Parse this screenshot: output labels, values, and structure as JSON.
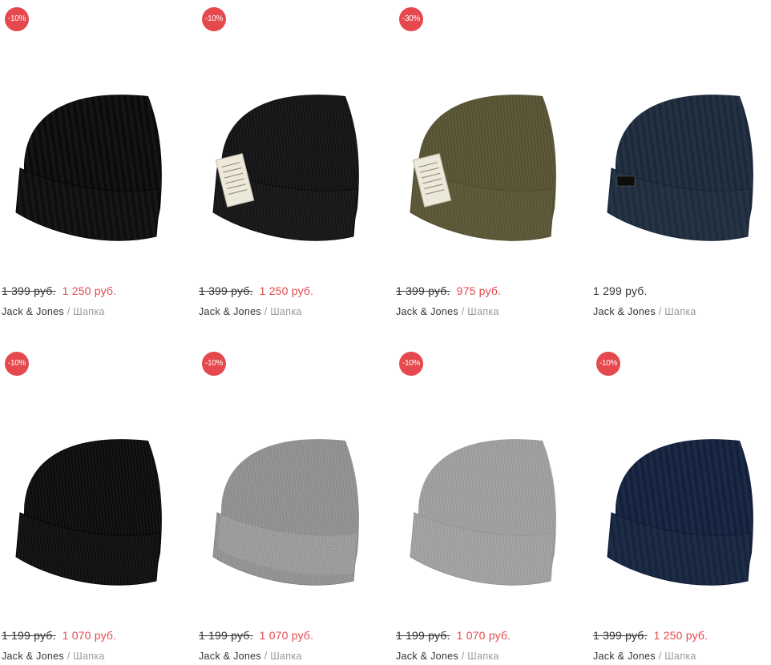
{
  "colors": {
    "accent": "#e5484d",
    "text": "#333333",
    "muted": "#999999"
  },
  "products": [
    {
      "discount": "-10%",
      "old_price": "1 399 руб.",
      "price": "1 250 руб.",
      "brand": "Jack & Jones",
      "separator": "/",
      "category": "Шапка",
      "hat_color": "#151515",
      "style": "ribbed",
      "patch": ""
    },
    {
      "discount": "-10%",
      "old_price": "1 399 руб.",
      "price": "1 250 руб.",
      "brand": "Jack & Jones",
      "separator": "/",
      "category": "Шапка",
      "hat_color": "#1c1c1f",
      "style": "fine",
      "patch": "label"
    },
    {
      "discount": "-30%",
      "old_price": "1 399 руб.",
      "price": "975 руб.",
      "brand": "Jack & Jones",
      "separator": "/",
      "category": "Шапка",
      "hat_color": "#5e5a3b",
      "style": "fine",
      "patch": "label"
    },
    {
      "discount": "",
      "old_price": "",
      "price": "1 299 руб.",
      "brand": "Jack & Jones",
      "separator": "/",
      "category": "Шапка",
      "hat_color": "#253244",
      "style": "ribbed",
      "patch": "tag"
    },
    {
      "discount": "-10%",
      "old_price": "1 199 руб.",
      "price": "1 070 руб.",
      "brand": "Jack & Jones",
      "separator": "/",
      "category": "Шапка",
      "hat_color": "#161616",
      "style": "fine",
      "patch": ""
    },
    {
      "discount": "-10%",
      "old_price": "1 199 руб.",
      "price": "1 070 руб.",
      "brand": "Jack & Jones",
      "separator": "/",
      "category": "Шапка",
      "hat_color": "#8a8a8a",
      "style": "melange",
      "patch": ""
    },
    {
      "discount": "-10%",
      "old_price": "1 199 руб.",
      "price": "1 070 руб.",
      "brand": "Jack & Jones",
      "separator": "/",
      "category": "Шапка",
      "hat_color": "#a3a3a3",
      "style": "fine",
      "patch": ""
    },
    {
      "discount": "-10%",
      "old_price": "1 399 руб.",
      "price": "1 250 руб.",
      "brand": "Jack & Jones",
      "separator": "/",
      "category": "Шапка",
      "hat_color": "#1d2a45",
      "style": "ribbed",
      "patch": ""
    }
  ]
}
